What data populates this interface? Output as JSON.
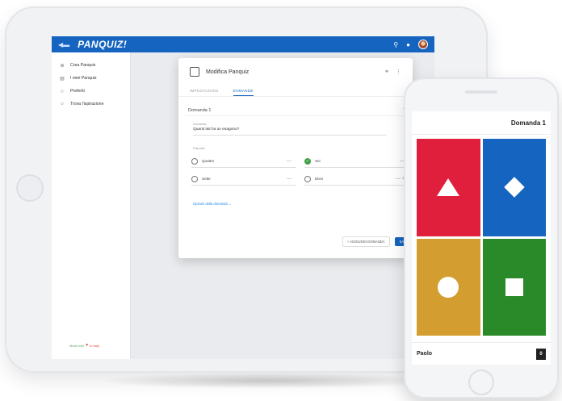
{
  "app": {
    "logo": "PANQUIZ!"
  },
  "appbar": {
    "menu_icon": "back-arrow-icon",
    "search_icon": "search-icon",
    "bell_icon": "bell-icon"
  },
  "sidebar": {
    "items": [
      {
        "label": "Crea Panquiz",
        "icon": "plus-circle-icon"
      },
      {
        "label": "I miei Panquiz",
        "icon": "list-box-icon"
      },
      {
        "label": "Preferiti",
        "icon": "star-icon"
      },
      {
        "label": "Trova l'ispirazione",
        "icon": "lightbulb-icon"
      }
    ],
    "footer": {
      "left": "Made with",
      "right": "in Italy"
    }
  },
  "dialog": {
    "title": "Modifica Panquiz",
    "tabs": [
      {
        "label": "IMPOSTAZIONI"
      },
      {
        "label": "DOMANDE"
      }
    ],
    "active_tab": 1,
    "question": {
      "heading": "Domanda 1",
      "field_label": "Domanda",
      "text": "Quanti lati ha un esagono?",
      "answers_label": "Risposte",
      "answers": [
        {
          "text": "Quattro",
          "correct": false
        },
        {
          "text": "Sei",
          "correct": true
        },
        {
          "text": "Sette",
          "correct": false
        },
        {
          "text": "Dieci",
          "correct": false
        }
      ]
    },
    "options_link": "Opzioni della domanda",
    "add_question": "+ AGGIUNGI DOMANDA",
    "save": "SALV"
  },
  "phone": {
    "question_title": "Domanda 1",
    "tiles": [
      {
        "color": "#e01f3d",
        "shape": "triangle"
      },
      {
        "color": "#1565c0",
        "shape": "diamond"
      },
      {
        "color": "#d39e2f",
        "shape": "circle"
      },
      {
        "color": "#2a8a2a",
        "shape": "square"
      }
    ],
    "player": {
      "name": "Paolo",
      "score": "0"
    }
  },
  "colors": {
    "brand_blue": "#1565c0",
    "correct_green": "#43a047"
  }
}
